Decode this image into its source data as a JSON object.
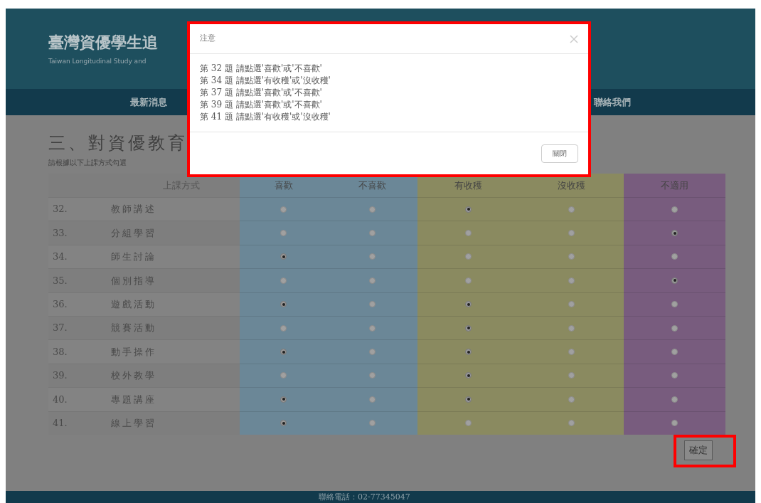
{
  "header": {
    "title": "臺灣資優學生追",
    "subtitle": "Taiwan Longitudinal Study and"
  },
  "nav": [
    {
      "label": "最新消息"
    },
    {
      "label": "聯絡我們"
    }
  ],
  "section": {
    "title": "三、對資優教育",
    "instruction": "請根據以下上課方式勾選"
  },
  "table": {
    "method_heading": "上課方式",
    "columns": [
      {
        "label": "喜歡",
        "color": "#6b8797"
      },
      {
        "label": "不喜歡",
        "color": "#6b8797"
      },
      {
        "label": "有收穫",
        "color": "#8a8a60"
      },
      {
        "label": "沒收穫",
        "color": "#8a8a60"
      },
      {
        "label": "不適用",
        "color": "#785c7e"
      }
    ],
    "rows": [
      {
        "number": "32.",
        "method": "教師講述",
        "choices": [
          {
            "selected": false
          },
          {
            "selected": false
          },
          {
            "selected": true
          },
          {
            "selected": false
          },
          {
            "selected": false
          }
        ]
      },
      {
        "number": "33.",
        "method": "分組學習",
        "choices": [
          {
            "selected": false
          },
          {
            "selected": false
          },
          {
            "selected": false
          },
          {
            "selected": false
          },
          {
            "selected": true
          }
        ]
      },
      {
        "number": "34.",
        "method": "師生討論",
        "choices": [
          {
            "selected": true
          },
          {
            "selected": false
          },
          {
            "selected": false
          },
          {
            "selected": false
          },
          {
            "selected": false
          }
        ]
      },
      {
        "number": "35.",
        "method": "個別指導",
        "choices": [
          {
            "selected": false
          },
          {
            "selected": false
          },
          {
            "selected": false
          },
          {
            "selected": false
          },
          {
            "selected": true
          }
        ]
      },
      {
        "number": "36.",
        "method": "遊戲活動",
        "choices": [
          {
            "selected": true
          },
          {
            "selected": false
          },
          {
            "selected": true
          },
          {
            "selected": false
          },
          {
            "selected": false
          }
        ]
      },
      {
        "number": "37.",
        "method": "競賽活動",
        "choices": [
          {
            "selected": false
          },
          {
            "selected": false
          },
          {
            "selected": true
          },
          {
            "selected": false
          },
          {
            "selected": false
          }
        ]
      },
      {
        "number": "38.",
        "method": "動手操作",
        "choices": [
          {
            "selected": true
          },
          {
            "selected": false
          },
          {
            "selected": true
          },
          {
            "selected": false
          },
          {
            "selected": false
          }
        ]
      },
      {
        "number": "39.",
        "method": "校外教學",
        "choices": [
          {
            "selected": false
          },
          {
            "selected": false
          },
          {
            "selected": true
          },
          {
            "selected": false
          },
          {
            "selected": false
          }
        ]
      },
      {
        "number": "40.",
        "method": "專題講座",
        "choices": [
          {
            "selected": true
          },
          {
            "selected": false
          },
          {
            "selected": true
          },
          {
            "selected": false
          },
          {
            "selected": false
          }
        ]
      },
      {
        "number": "41.",
        "method": "線上學習",
        "choices": [
          {
            "selected": true
          },
          {
            "selected": false
          },
          {
            "selected": false
          },
          {
            "selected": false
          },
          {
            "selected": false
          }
        ]
      }
    ]
  },
  "submit_button": "確定",
  "dialog": {
    "title": "注意",
    "messages": [
      "第 32 題 請點選'喜歡'或'不喜歡'",
      "第 34 題 請點選'有收穫'或'沒收穫'",
      "第 37 題 請點選'喜歡'或'不喜歡'",
      "第 39 題 請點選'喜歡'或'不喜歡'",
      "第 41 題 請點選'有收穫'或'沒收穫'"
    ],
    "close_button": "關閉"
  },
  "footer": [
    "聯絡電話：02-77345047"
  ]
}
